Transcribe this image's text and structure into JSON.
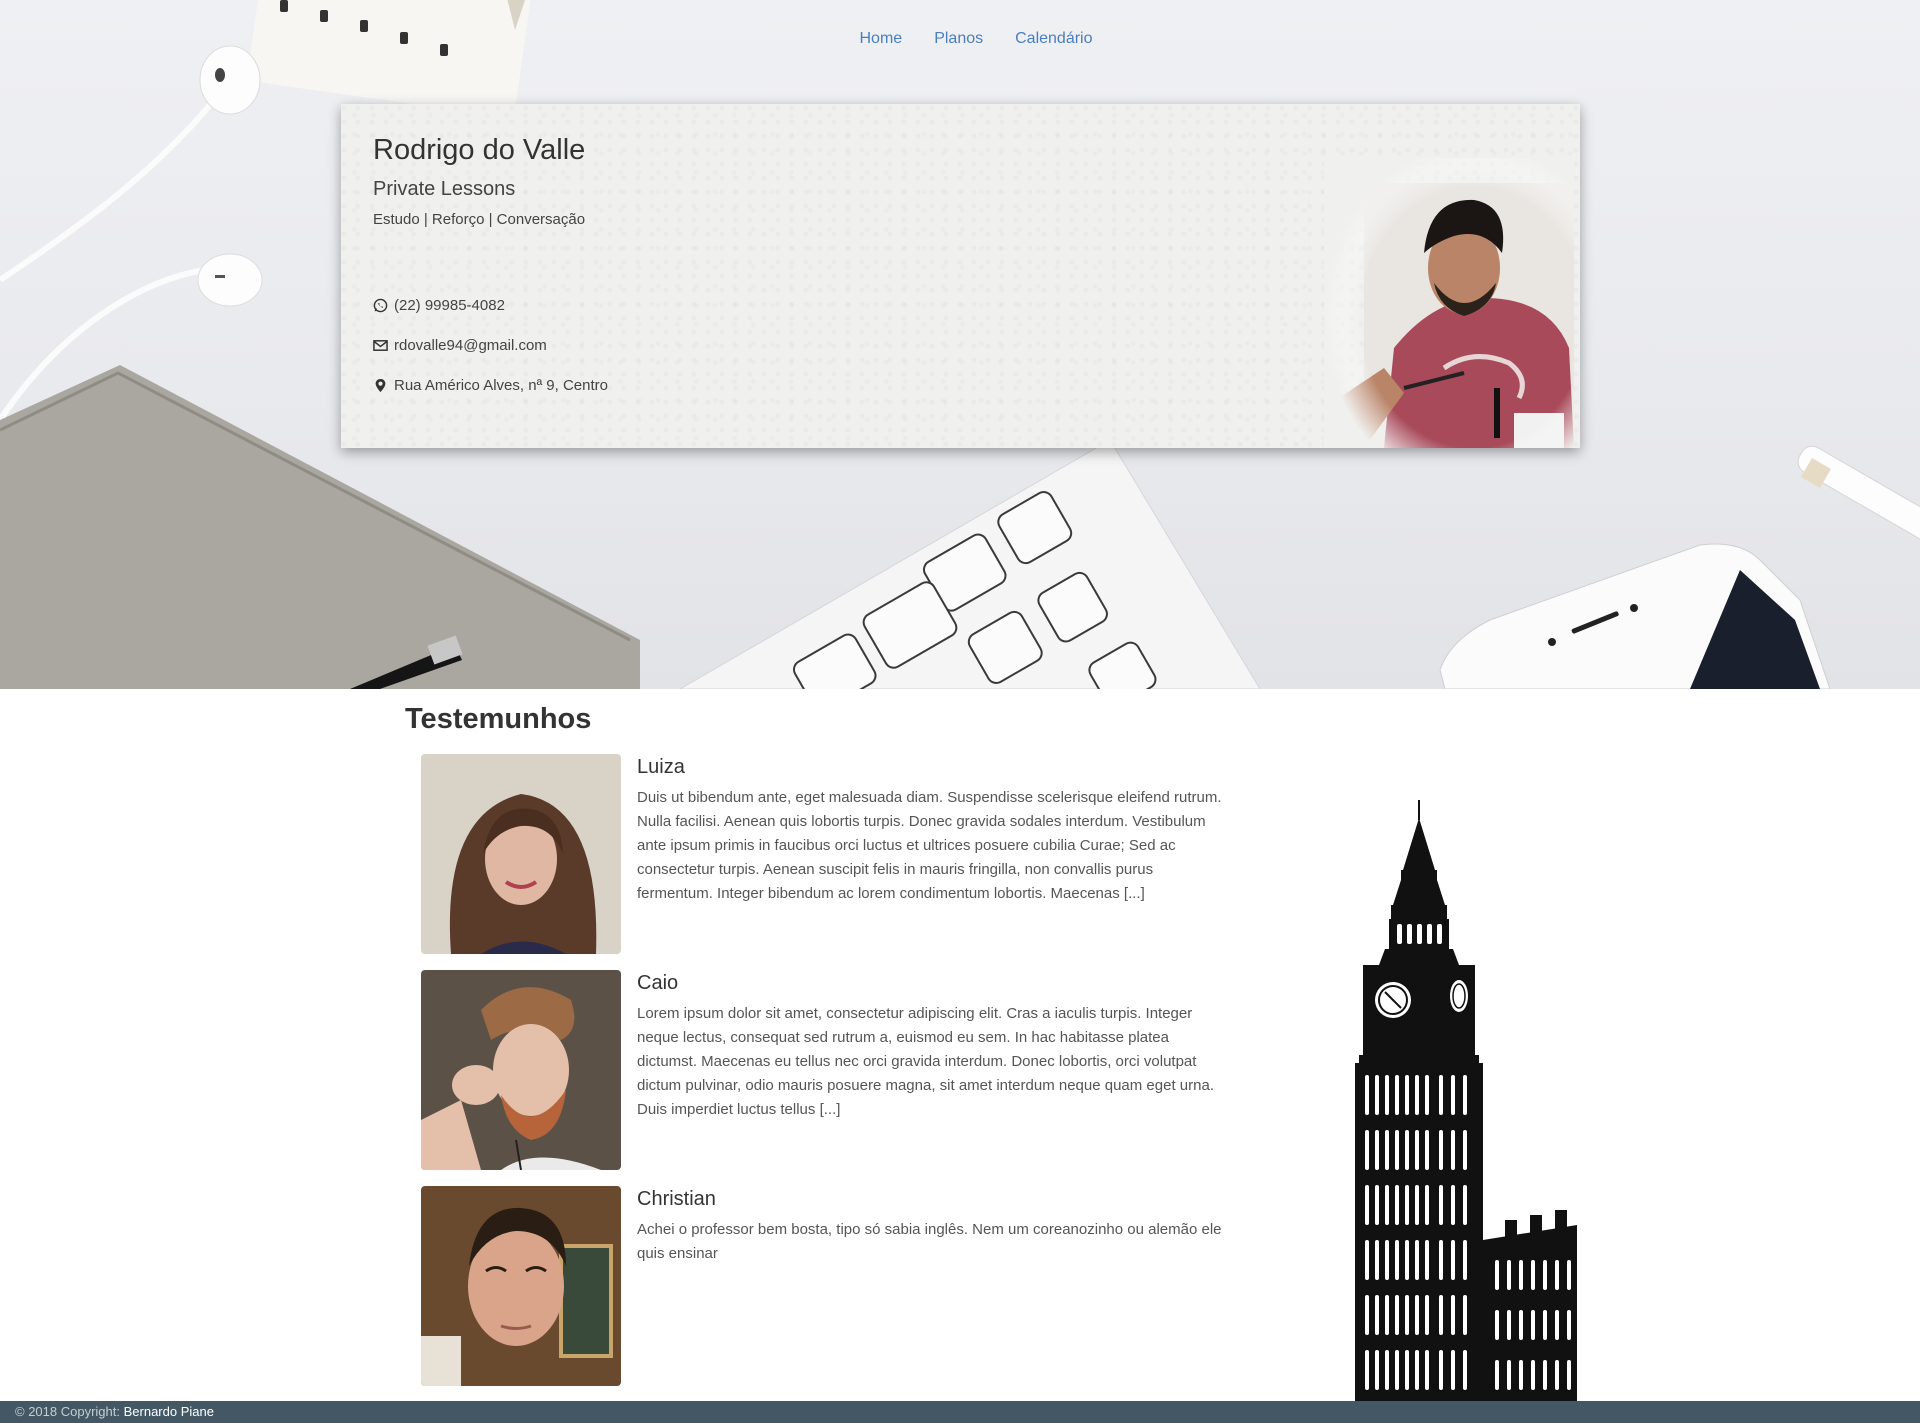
{
  "nav": {
    "items": [
      {
        "label": "Home"
      },
      {
        "label": "Planos"
      },
      {
        "label": "Calendário"
      }
    ]
  },
  "profile": {
    "name": "Rodrigo do Valle",
    "subtitle": "Private Lessons",
    "tags": "Estudo | Reforço | Conversação",
    "phone": "(22) 99985-4082",
    "email": "rdovalle94@gmail.com",
    "address": "Rua Américo Alves, nª 9, Centro"
  },
  "testimonials": {
    "title": "Testemunhos",
    "items": [
      {
        "name": "Luiza",
        "text": "Duis ut bibendum ante, eget malesuada diam. Suspendisse scelerisque eleifend rutrum. Nulla facilisi. Aenean quis lobortis turpis. Donec gravida sodales interdum. Vestibulum ante ipsum primis in faucibus orci luctus et ultrices posuere cubilia Curae; Sed ac consectetur turpis. Aenean suscipit felis in mauris fringilla, non convallis purus fermentum. Integer bibendum ac lorem condimentum lobortis. Maecenas [...]"
      },
      {
        "name": "Caio",
        "text": "Lorem ipsum dolor sit amet, consectetur adipiscing elit. Cras a iaculis turpis. Integer neque lectus, consequat sed rutrum a, euismod eu sem. In hac habitasse platea dictumst. Maecenas eu tellus nec orci gravida interdum. Donec lobortis, orci volutpat dictum pulvinar, odio mauris posuere magna, sit amet interdum neque quam eget urna. Duis imperdiet luctus tellus [...]"
      },
      {
        "name": "Christian",
        "text": "Achei o professor bem bosta, tipo só sabia inglês. Nem um coreanozinho ou alemão ele quis ensinar"
      }
    ]
  },
  "footer": {
    "prefix": "© 2018 Copyright:",
    "author": "Bernardo Piane"
  },
  "icons": {
    "phone": "whatsapp-icon",
    "email": "envelope-icon",
    "address": "map-marker-icon"
  },
  "colors": {
    "link": "#4a7fbf",
    "footer_bg": "#435864"
  }
}
